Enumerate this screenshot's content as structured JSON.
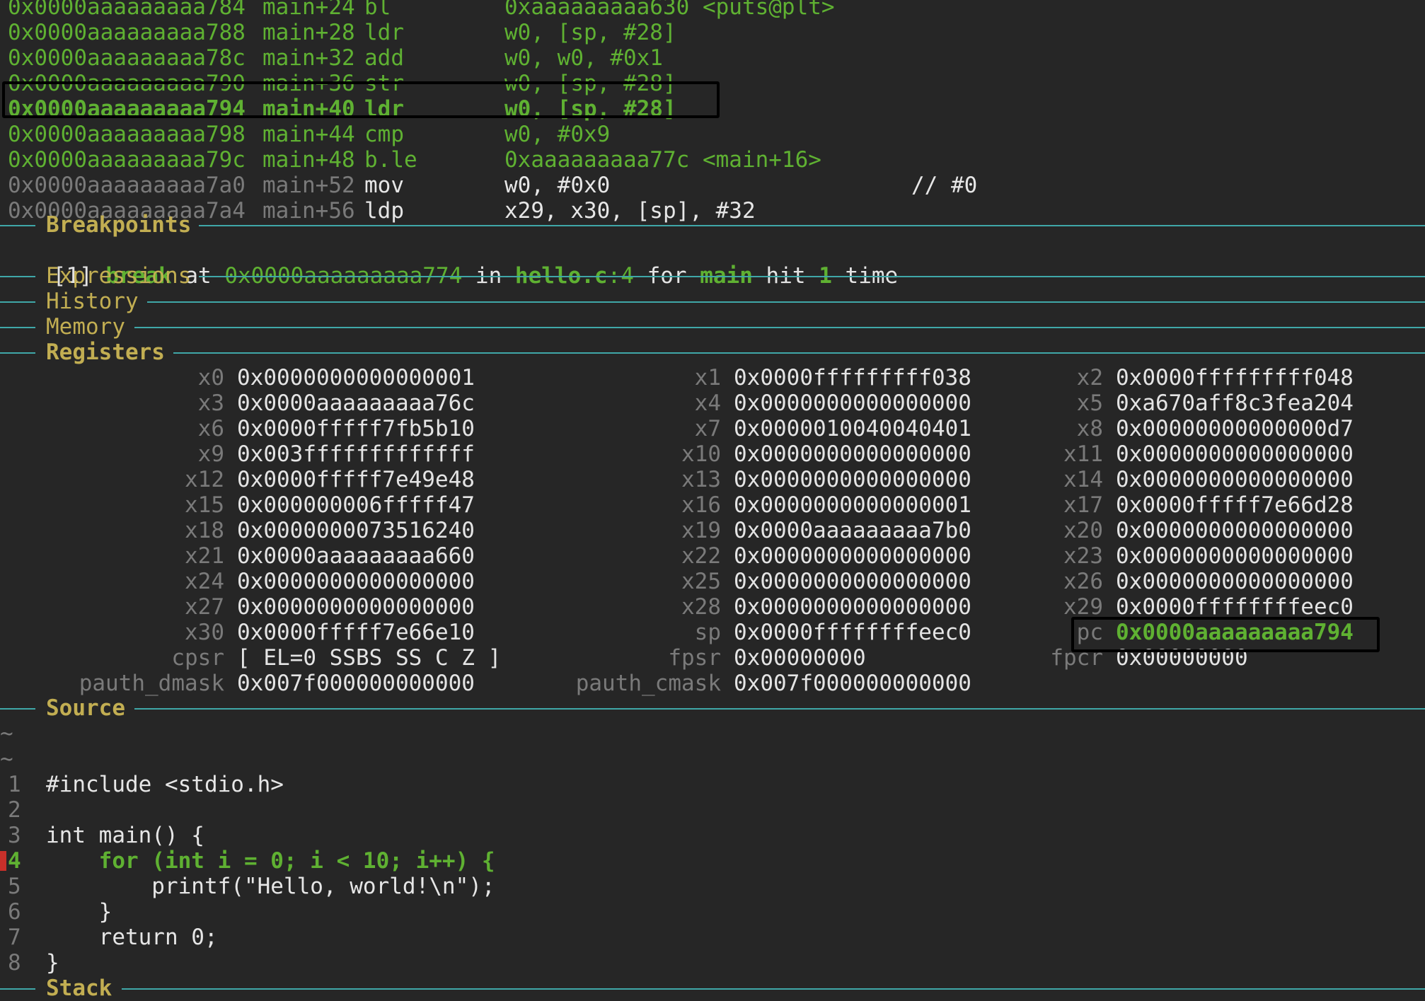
{
  "disassembly": [
    {
      "addr": "0x0000aaaaaaaaa784",
      "off": "main+24",
      "op": "bl",
      "args": "0xaaaaaaaaa630 <puts@plt>",
      "state": "past"
    },
    {
      "addr": "0x0000aaaaaaaaa788",
      "off": "main+28",
      "op": "ldr",
      "args": "w0, [sp, #28]",
      "state": "past"
    },
    {
      "addr": "0x0000aaaaaaaaa78c",
      "off": "main+32",
      "op": "add",
      "args": "w0, w0, #0x1",
      "state": "past"
    },
    {
      "addr": "0x0000aaaaaaaaa790",
      "off": "main+36",
      "op": "str",
      "args": "w0, [sp, #28]",
      "state": "past"
    },
    {
      "addr": "0x0000aaaaaaaaa794",
      "off": "main+40",
      "op": "ldr",
      "args": "w0, [sp, #28]",
      "state": "current"
    },
    {
      "addr": "0x0000aaaaaaaaa798",
      "off": "main+44",
      "op": "cmp",
      "args": "w0, #0x9",
      "state": "past"
    },
    {
      "addr": "0x0000aaaaaaaaa79c",
      "off": "main+48",
      "op": "b.le",
      "args": "0xaaaaaaaaa77c <main+16>",
      "state": "past"
    },
    {
      "addr": "0x0000aaaaaaaaa7a0",
      "off": "main+52",
      "op": "mov",
      "args": "w0, #0x0",
      "comment": "// #0",
      "state": "future"
    },
    {
      "addr": "0x0000aaaaaaaaa7a4",
      "off": "main+56",
      "op": "ldp",
      "args": "x29, x30, [sp], #32",
      "state": "future"
    }
  ],
  "sections": {
    "breakpoints": "Breakpoints",
    "expressions": "Expressions",
    "history": "History",
    "memory": "Memory",
    "registers": "Registers",
    "source": "Source",
    "stack": "Stack"
  },
  "breakpoint": {
    "num": "[1]",
    "kw": "break",
    "at": " at ",
    "addr": "0x0000aaaaaaaaa774",
    "in": " in ",
    "file": "hello.c",
    "line": ":4",
    "for": " for ",
    "func": "main",
    "hit": " hit ",
    "count": "1",
    "time": " time"
  },
  "registers": [
    [
      {
        "n": "x0",
        "v": "0x0000000000000001"
      },
      {
        "n": "x1",
        "v": "0x0000fffffffff038"
      },
      {
        "n": "x2",
        "v": "0x0000fffffffff048"
      }
    ],
    [
      {
        "n": "x3",
        "v": "0x0000aaaaaaaaa76c"
      },
      {
        "n": "x4",
        "v": "0x0000000000000000"
      },
      {
        "n": "x5",
        "v": "0xa670aff8c3fea204"
      }
    ],
    [
      {
        "n": "x6",
        "v": "0x0000fffff7fb5b10"
      },
      {
        "n": "x7",
        "v": "0x0000010040040401"
      },
      {
        "n": "x8",
        "v": "0x00000000000000d7"
      }
    ],
    [
      {
        "n": "x9",
        "v": "0x003fffffffffffff"
      },
      {
        "n": "x10",
        "v": "0x0000000000000000"
      },
      {
        "n": "x11",
        "v": "0x0000000000000000"
      }
    ],
    [
      {
        "n": "x12",
        "v": "0x0000fffff7e49e48"
      },
      {
        "n": "x13",
        "v": "0x0000000000000000"
      },
      {
        "n": "x14",
        "v": "0x0000000000000000"
      }
    ],
    [
      {
        "n": "x15",
        "v": "0x000000006fffff47"
      },
      {
        "n": "x16",
        "v": "0x0000000000000001"
      },
      {
        "n": "x17",
        "v": "0x0000fffff7e66d28"
      }
    ],
    [
      {
        "n": "x18",
        "v": "0x0000000073516240"
      },
      {
        "n": "x19",
        "v": "0x0000aaaaaaaaa7b0"
      },
      {
        "n": "x20",
        "v": "0x0000000000000000"
      }
    ],
    [
      {
        "n": "x21",
        "v": "0x0000aaaaaaaaa660"
      },
      {
        "n": "x22",
        "v": "0x0000000000000000"
      },
      {
        "n": "x23",
        "v": "0x0000000000000000"
      }
    ],
    [
      {
        "n": "x24",
        "v": "0x0000000000000000"
      },
      {
        "n": "x25",
        "v": "0x0000000000000000"
      },
      {
        "n": "x26",
        "v": "0x0000000000000000"
      }
    ],
    [
      {
        "n": "x27",
        "v": "0x0000000000000000"
      },
      {
        "n": "x28",
        "v": "0x0000000000000000"
      },
      {
        "n": "x29",
        "v": "0x0000ffffffffeec0"
      }
    ],
    [
      {
        "n": "x30",
        "v": "0x0000fffff7e66e10"
      },
      {
        "n": "sp",
        "v": "0x0000ffffffffeec0"
      },
      {
        "n": "pc",
        "v": "0x0000aaaaaaaaa794",
        "changed": true
      }
    ],
    [
      {
        "n": "cpsr",
        "v": "[ EL=0 SSBS SS C Z ]"
      },
      {
        "n": "fpsr",
        "v": "0x00000000"
      },
      {
        "n": "fpcr",
        "v": "0x00000000"
      }
    ],
    [
      {
        "n": "pauth_dmask",
        "v": "0x007f000000000000"
      },
      {
        "n": "pauth_cmask",
        "v": "0x007f000000000000"
      }
    ]
  ],
  "source": {
    "tildes": [
      "~",
      "~"
    ],
    "lines": [
      {
        "num": "1",
        "text": "#include <stdio.h>"
      },
      {
        "num": "2",
        "text": ""
      },
      {
        "num": "3",
        "text": "int main() {"
      },
      {
        "num": "4",
        "text": "    for (int i = 0; i < 10; i++) {",
        "current": true,
        "breakpoint": "!"
      },
      {
        "num": "5",
        "text": "        printf(\"Hello, world!\\n\");"
      },
      {
        "num": "6",
        "text": "    }"
      },
      {
        "num": "7",
        "text": "    return 0;"
      },
      {
        "num": "8",
        "text": "}"
      }
    ]
  },
  "colors": {
    "background": "#262626",
    "green": "#5fb132",
    "yellow": "#c2ae52",
    "dim": "#7a7a7a",
    "rule": "#3fa7a8",
    "breakpoint_marker": "#c8302a",
    "highlight_box": "#000000"
  }
}
